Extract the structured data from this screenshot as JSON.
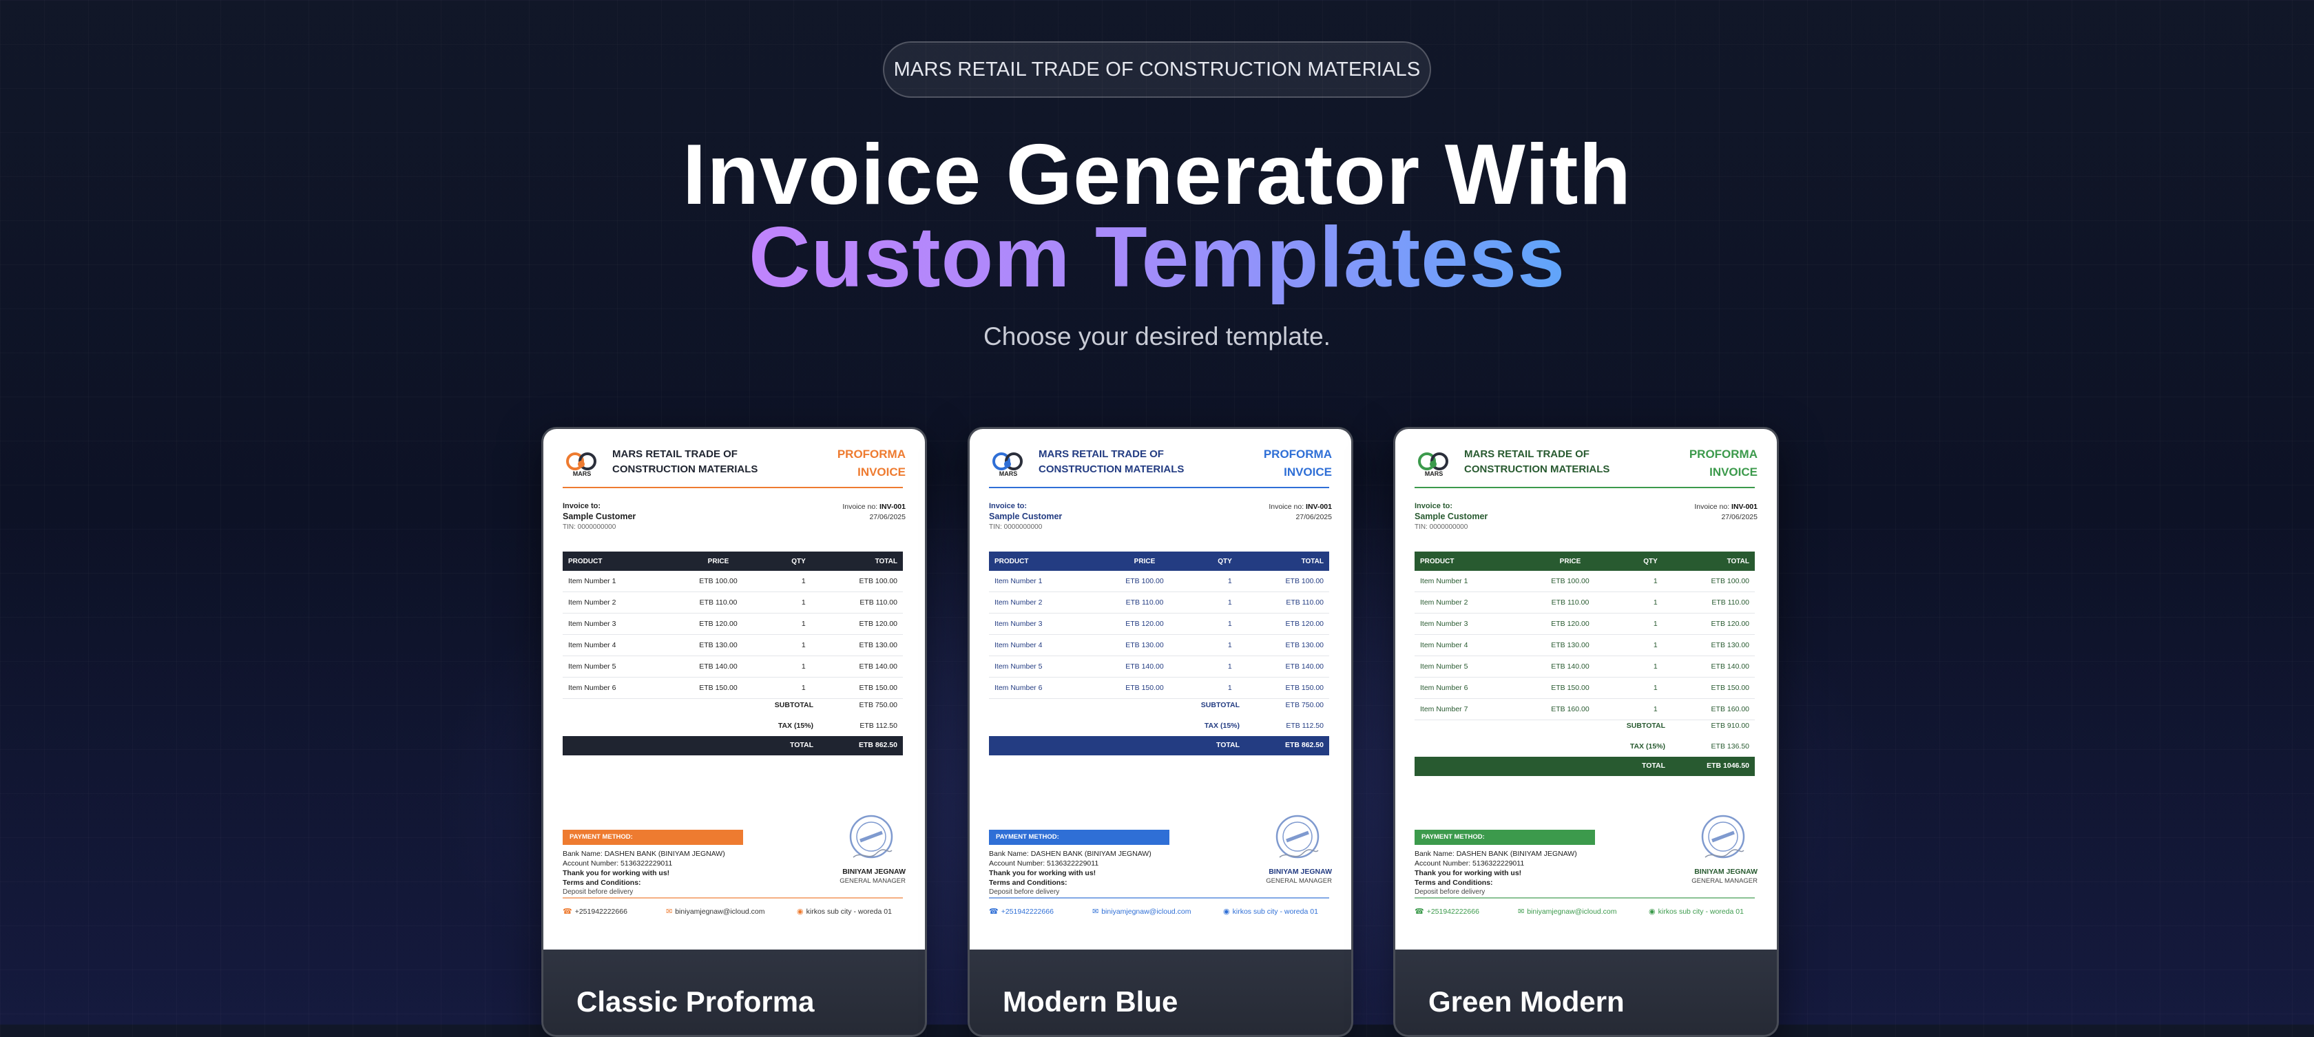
{
  "header": {
    "badge": "MARS RETAIL TRADE OF CONSTRUCTION MATERIALS",
    "title_line1": "Invoice Generator With",
    "title_line2": "Custom Templatess",
    "subtitle": "Choose your desired template."
  },
  "templates": [
    {
      "name": "Classic Proforma",
      "accent": "#ee7b30",
      "table_header_bg": "#1f2430",
      "text_color": "#222222",
      "company_name": [
        "MARS RETAIL TRADE OF",
        "CONSTRUCTION MATERIALS"
      ],
      "logo_text": "MARS",
      "invoice_title": [
        "PROFORMA",
        "INVOICE"
      ],
      "invoice_to_label": "Invoice to:",
      "customer_name": "Sample Customer",
      "tin": "TIN: 0000000000",
      "invoice_no_label": "Invoice no:",
      "invoice_no": "INV-001",
      "date": "27/06/2025",
      "columns": [
        "PRODUCT",
        "PRICE",
        "QTY",
        "TOTAL"
      ],
      "items": [
        [
          "Item Number 1",
          "ETB 100.00",
          "1",
          "ETB 100.00"
        ],
        [
          "Item Number 2",
          "ETB 110.00",
          "1",
          "ETB 110.00"
        ],
        [
          "Item Number 3",
          "ETB 120.00",
          "1",
          "ETB 120.00"
        ],
        [
          "Item Number 4",
          "ETB 130.00",
          "1",
          "ETB 130.00"
        ],
        [
          "Item Number 5",
          "ETB 140.00",
          "1",
          "ETB 140.00"
        ],
        [
          "Item Number 6",
          "ETB 150.00",
          "1",
          "ETB 150.00"
        ]
      ],
      "subtotal_label": "SUBTOTAL",
      "subtotal": "ETB 750.00",
      "tax_label": "TAX (15%)",
      "tax": "ETB 112.50",
      "total_label": "TOTAL",
      "total": "ETB 862.50",
      "payment_label": "PAYMENT METHOD:",
      "bank": "Bank Name: DASHEN BANK (BINIYAM JEGNAW)",
      "account": "Account Number: 5136322229011",
      "thanks": "Thank you for working with us!",
      "terms_label": "Terms and Conditions:",
      "terms": "Deposit before delivery",
      "signer_name": "BINIYAM JEGNAW",
      "signer_title": "GENERAL MANAGER",
      "phone": "+251942222666",
      "email": "biniyamjegnaw@icloud.com",
      "address": "kirkos sub city - woreda 01"
    },
    {
      "name": "Modern Blue",
      "accent": "#2f6fd6",
      "table_header_bg": "#233c82",
      "text_color": "#233c82",
      "company_name": [
        "MARS RETAIL TRADE OF",
        "CONSTRUCTION MATERIALS"
      ],
      "logo_text": "MARS",
      "invoice_title": [
        "PROFORMA",
        "INVOICE"
      ],
      "invoice_to_label": "Invoice to:",
      "customer_name": "Sample Customer",
      "tin": "TIN: 0000000000",
      "invoice_no_label": "Invoice no:",
      "invoice_no": "INV-001",
      "date": "27/06/2025",
      "columns": [
        "PRODUCT",
        "PRICE",
        "QTY",
        "TOTAL"
      ],
      "items": [
        [
          "Item Number 1",
          "ETB 100.00",
          "1",
          "ETB 100.00"
        ],
        [
          "Item Number 2",
          "ETB 110.00",
          "1",
          "ETB 110.00"
        ],
        [
          "Item Number 3",
          "ETB 120.00",
          "1",
          "ETB 120.00"
        ],
        [
          "Item Number 4",
          "ETB 130.00",
          "1",
          "ETB 130.00"
        ],
        [
          "Item Number 5",
          "ETB 140.00",
          "1",
          "ETB 140.00"
        ],
        [
          "Item Number 6",
          "ETB 150.00",
          "1",
          "ETB 150.00"
        ]
      ],
      "subtotal_label": "SUBTOTAL",
      "subtotal": "ETB 750.00",
      "tax_label": "TAX (15%)",
      "tax": "ETB 112.50",
      "total_label": "TOTAL",
      "total": "ETB 862.50",
      "payment_label": "PAYMENT METHOD:",
      "bank": "Bank Name: DASHEN BANK (BINIYAM JEGNAW)",
      "account": "Account Number: 5136322229011",
      "thanks": "Thank you for working with us!",
      "terms_label": "Terms and Conditions:",
      "terms": "Deposit before delivery",
      "signer_name": "BINIYAM JEGNAW",
      "signer_title": "GENERAL MANAGER",
      "phone": "+251942222666",
      "email": "biniyamjegnaw@icloud.com",
      "address": "kirkos sub city - woreda 01"
    },
    {
      "name": "Green Modern",
      "accent": "#3c9a4c",
      "table_header_bg": "#285a30",
      "text_color": "#285a30",
      "company_name": [
        "MARS RETAIL TRADE OF",
        "CONSTRUCTION MATERIALS"
      ],
      "logo_text": "MARS",
      "invoice_title": [
        "PROFORMA",
        "INVOICE"
      ],
      "invoice_to_label": "Invoice to:",
      "customer_name": "Sample Customer",
      "tin": "TIN: 0000000000",
      "invoice_no_label": "Invoice no:",
      "invoice_no": "INV-001",
      "date": "27/06/2025",
      "columns": [
        "PRODUCT",
        "PRICE",
        "QTY",
        "TOTAL"
      ],
      "items": [
        [
          "Item Number 1",
          "ETB 100.00",
          "1",
          "ETB 100.00"
        ],
        [
          "Item Number 2",
          "ETB 110.00",
          "1",
          "ETB 110.00"
        ],
        [
          "Item Number 3",
          "ETB 120.00",
          "1",
          "ETB 120.00"
        ],
        [
          "Item Number 4",
          "ETB 130.00",
          "1",
          "ETB 130.00"
        ],
        [
          "Item Number 5",
          "ETB 140.00",
          "1",
          "ETB 140.00"
        ],
        [
          "Item Number 6",
          "ETB 150.00",
          "1",
          "ETB 150.00"
        ],
        [
          "Item Number 7",
          "ETB 160.00",
          "1",
          "ETB 160.00"
        ]
      ],
      "subtotal_label": "SUBTOTAL",
      "subtotal": "ETB 910.00",
      "tax_label": "TAX (15%)",
      "tax": "ETB 136.50",
      "total_label": "TOTAL",
      "total": "ETB 1046.50",
      "payment_label": "PAYMENT METHOD:",
      "bank": "Bank Name: DASHEN BANK (BINIYAM JEGNAW)",
      "account": "Account Number: 5136322229011",
      "thanks": "Thank you for working with us!",
      "terms_label": "Terms and Conditions:",
      "terms": "Deposit before delivery",
      "signer_name": "BINIYAM JEGNAW",
      "signer_title": "GENERAL MANAGER",
      "phone": "+251942222666",
      "email": "biniyamjegnaw@icloud.com",
      "address": "kirkos sub city - woreda 01"
    }
  ]
}
